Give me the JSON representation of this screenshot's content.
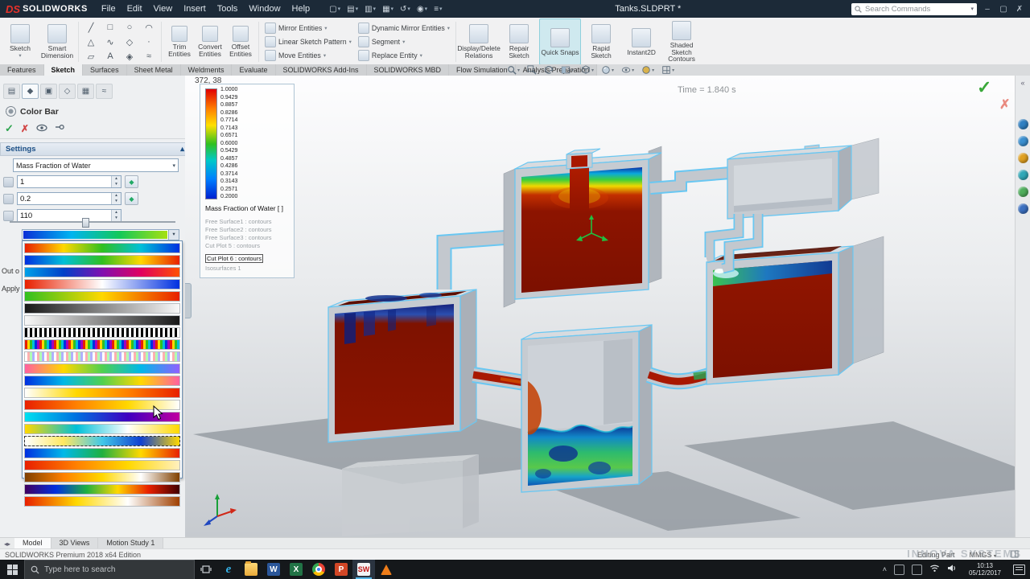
{
  "titlebar": {
    "brand_mark": "DS",
    "brand": "SOLIDWORKS",
    "title": "Tanks.SLDPRT *",
    "search_placeholder": "Search Commands",
    "menus": [
      "File",
      "Edit",
      "View",
      "Insert",
      "Tools",
      "Window",
      "Help"
    ],
    "quick_access": [
      {
        "name": "new",
        "glyph": "▢"
      },
      {
        "name": "open",
        "glyph": "▤"
      },
      {
        "name": "save",
        "glyph": "▥"
      },
      {
        "name": "print",
        "glyph": "▦"
      },
      {
        "name": "undo",
        "glyph": "↺"
      },
      {
        "name": "rebuild",
        "glyph": "◉"
      },
      {
        "name": "options",
        "glyph": "≡"
      }
    ]
  },
  "ribbon": {
    "primary_buttons": [
      {
        "label": "Sketch",
        "caret": "▾"
      },
      {
        "label": "Smart Dimension",
        "caret": ""
      }
    ],
    "tool_grid": [
      "╱",
      "□",
      "○",
      "◠",
      "△",
      "∿",
      "◇",
      "·",
      "▱",
      "A",
      "◈",
      "≈"
    ],
    "medium_buttons": [
      "Trim Entities",
      "Convert Entities",
      "Offset Entities"
    ],
    "stack_a": [
      "Mirror Entities",
      "Linear Sketch Pattern",
      "Move Entities"
    ],
    "stack_b": [
      "Dynamic Mirror Entities",
      "Segment",
      "Replace Entity"
    ],
    "tall_buttons": [
      "Display/Delete Relations",
      "Repair Sketch",
      "Quick Snaps",
      "Rapid Sketch",
      "Instant2D",
      "Shaded Sketch Contours"
    ],
    "highlighted_button": "Quick Snaps"
  },
  "tabs": {
    "items": [
      "Features",
      "Sketch",
      "Surfaces",
      "Sheet Metal",
      "Weldments",
      "Evaluate",
      "SOLIDWORKS Add-Ins",
      "SOLIDWORKS MBD",
      "Flow Simulation",
      "Analysis Preparation"
    ],
    "active": "Sketch"
  },
  "panel": {
    "title": "Color Bar",
    "settings_label": "Settings",
    "settings_chevron": "▴",
    "parameter_value": "Mass Fraction of Water",
    "inputs": [
      {
        "value": "1"
      },
      {
        "value": "0.2"
      },
      {
        "value": "110"
      }
    ],
    "slider_percent": 45,
    "clipped_labels": [
      "Out o",
      "Apply"
    ],
    "tabs": [
      {
        "name": "featuremanager",
        "glyph": "▤",
        "active": false
      },
      {
        "name": "propertymanager",
        "glyph": "◆",
        "active": true
      },
      {
        "name": "configurationmanager",
        "glyph": "▣",
        "active": false
      },
      {
        "name": "dimxpertmanager",
        "glyph": "◇",
        "active": false
      },
      {
        "name": "displaymanager",
        "glyph": "▦",
        "active": false
      },
      {
        "name": "simulation-tree",
        "glyph": "≈",
        "active": false
      }
    ],
    "palette_current": {
      "colors": [
        "#0a2fd6",
        "#00b4f0",
        "#12c85a",
        "#a6e010"
      ]
    },
    "palette_rows": [
      {
        "colors": [
          "#e82000",
          "#ffd800",
          "#30c020",
          "#00c0d8",
          "#0030e0"
        ]
      },
      {
        "colors": [
          "#0030e0",
          "#00c0d8",
          "#30c020",
          "#ffd800",
          "#e82000"
        ]
      },
      {
        "colors": [
          "#00a0e8",
          "#0040c8",
          "#8010b0",
          "#e00060",
          "#ff5000"
        ]
      },
      {
        "colors": [
          "#e82000",
          "#ffffff",
          "#0030e0"
        ]
      },
      {
        "colors": [
          "#30c020",
          "#ffd800",
          "#e82000"
        ]
      },
      {
        "colors": [
          "#181818",
          "#f8f8f8"
        ]
      },
      {
        "colors": [
          "#f8f8f8",
          "#181818"
        ]
      },
      {
        "colors": [
          "#000000",
          "#ffffff"
        ],
        "striped": true
      },
      {
        "colors": [
          "#e82000",
          "#ffd800",
          "#30c020",
          "#00c0d8",
          "#0030e0",
          "#a000c0"
        ],
        "striped": true
      },
      {
        "colors": [
          "#ffffff",
          "#ffb0b0",
          "#b0ffb0",
          "#b0b0ff"
        ],
        "striped": true
      },
      {
        "colors": [
          "#ff60a0",
          "#ffd800",
          "#50d050",
          "#00b8e8",
          "#9060ff"
        ]
      },
      {
        "colors": [
          "#0030e0",
          "#00b8e8",
          "#50d050",
          "#ffd800",
          "#ff60a0"
        ]
      },
      {
        "colors": [
          "#ffffff",
          "#ffd800",
          "#ff8000",
          "#e82000"
        ]
      },
      {
        "colors": [
          "#e82000",
          "#ff8000",
          "#ffd800",
          "#ffffff"
        ]
      },
      {
        "colors": [
          "#00e0f0",
          "#0070e0",
          "#4000c0",
          "#c000a0"
        ]
      },
      {
        "colors": [
          "#ffd800",
          "#00c0d8",
          "#ffffff",
          "#ffd800"
        ]
      },
      {
        "colors": [
          "#ffffff",
          "#ffe860",
          "#40c8e8",
          "#1040d0",
          "#ffd800"
        ],
        "selected": true
      },
      {
        "colors": [
          "#0030e0",
          "#00b8e8",
          "#20b040",
          "#ffd800",
          "#e82000"
        ]
      },
      {
        "colors": [
          "#e82000",
          "#ff8000",
          "#ffd800",
          "#fff0c0"
        ]
      },
      {
        "colors": [
          "#804000",
          "#ff8000",
          "#ffd800",
          "#ffffff",
          "#804000"
        ]
      },
      {
        "colors": [
          "#400060",
          "#0030e0",
          "#20b040",
          "#ffd800",
          "#e82000",
          "#400000"
        ]
      },
      {
        "colors": [
          "#e82000",
          "#ffd800",
          "#ffffff",
          "#a04000"
        ]
      }
    ]
  },
  "legend": {
    "values": [
      "1.0000",
      "0.9429",
      "0.8857",
      "0.8286",
      "0.7714",
      "0.7143",
      "0.6571",
      "0.6000",
      "0.5429",
      "0.4857",
      "0.4286",
      "0.3714",
      "0.3143",
      "0.2571",
      "0.2000"
    ],
    "title": "Mass Fraction of Water [ ]",
    "items": [
      "Free Surface1 : contours",
      "Free Surface2 : contours",
      "Free Surface3 : contours",
      "Cut Plot 5 : contours",
      "Cut Plot 6 : contours",
      "Isosurfaces 1"
    ],
    "highlighted_item": "Cut Plot 6 : contours"
  },
  "viewport": {
    "coords": "372, 38",
    "time_label": "Time = 1.840 s"
  },
  "right_strip": {
    "collapse_glyph": "«",
    "icons": [
      {
        "name": "resources",
        "color": "#2e7fc2"
      },
      {
        "name": "design-library",
        "color": "#3a8fd0"
      },
      {
        "name": "file-explorer",
        "color": "#e0a020"
      },
      {
        "name": "view-palette",
        "color": "#2fa8b8"
      },
      {
        "name": "appearances",
        "color": "#4fae5c"
      },
      {
        "name": "custom-properties",
        "color": "#3a6fc0"
      }
    ]
  },
  "bottom_tabs": {
    "items": [
      "Model",
      "3D Views",
      "Motion Study 1"
    ],
    "active": "Model"
  },
  "status": {
    "left": "SOLIDWORKS Premium 2018 x64 Edition",
    "editing_label": "Editing Part",
    "units_label": "MMGS",
    "units_caret": "▾",
    "watermark": "INNOVA SYSTEMS"
  },
  "taskbar": {
    "search_placeholder": "Type here to search",
    "apps": [
      {
        "name": "edge",
        "label": "e"
      },
      {
        "name": "explorer"
      },
      {
        "name": "word",
        "label": "W"
      },
      {
        "name": "excel",
        "label": "X"
      },
      {
        "name": "chrome"
      },
      {
        "name": "powerpoint",
        "label": "P"
      },
      {
        "name": "solidworks",
        "label": "SW",
        "active": true
      },
      {
        "name": "vlc"
      }
    ],
    "clock": {
      "time": "10:13",
      "date": "05/12/2017"
    }
  },
  "scene_colors": {
    "fluid_red": "#8d1400",
    "edge_highlight": "#69c7f2",
    "tank_gray": "#c9cdd3",
    "shadow_gray": "#8f959c"
  }
}
